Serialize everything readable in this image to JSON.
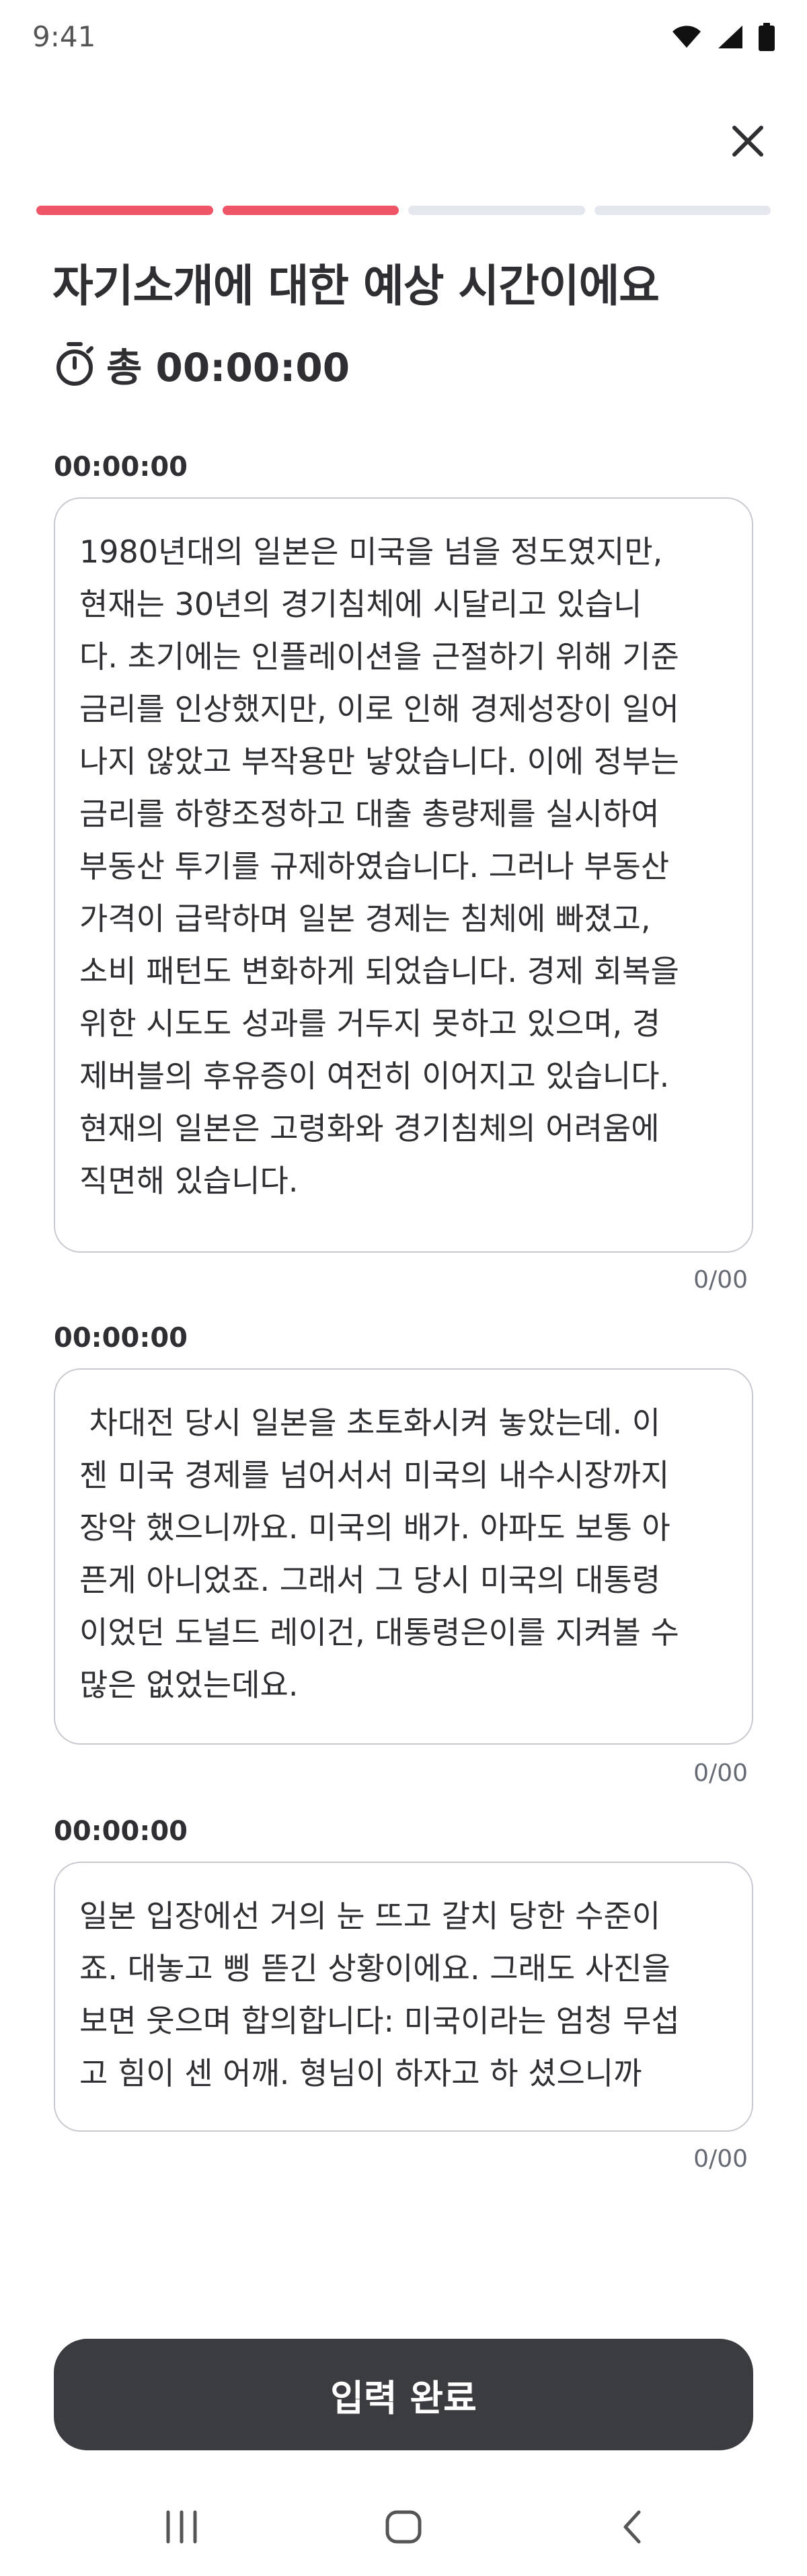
{
  "status_bar": {
    "time": "9:41",
    "icons": [
      "wifi-icon",
      "signal-icon",
      "battery-icon"
    ]
  },
  "header": {
    "close_icon": "close-icon"
  },
  "progress": {
    "total_steps": 4,
    "current_step": 2,
    "active_color": "#ee5566",
    "inactive_color": "#e5e7ee"
  },
  "title": "자기소개에 대한 예상 시간이에요",
  "total": {
    "icon": "stopwatch-icon",
    "label": "총 00:00:00"
  },
  "sections": [
    {
      "time": "00:00:00",
      "text": "1980년대의 일본은 미국을 넘을 정도였지만,\n현재는 30년의 경기침체에 시달리고 있습니\n다. 초기에는 인플레이션을 근절하기 위해 기준\n금리를 인상했지만, 이로 인해 경제성장이 일어\n나지 않았고 부작용만 낳았습니다. 이에 정부는\n금리를 하향조정하고 대출 총량제를 실시하여\n부동산 투기를 규제하였습니다. 그러나 부동산\n가격이 급락하며 일본 경제는 침체에 빠졌고,\n소비 패턴도 변화하게 되었습니다. 경제 회복을\n위한 시도도 성과를 거두지 못하고 있으며, 경\n제버블의 후유증이 여전히 이어지고 있습니다.\n현재의 일본은 고령화와 경기침체의 어려움에\n직면해 있습니다.",
      "count": "0/00"
    },
    {
      "time": "00:00:00",
      "text": " 차대전 당시 일본을 초토화시켜 놓았는데. 이\n젠 미국 경제를 넘어서서 미국의 내수시장까지\n장악 했으니까요. 미국의 배가. 아파도 보통 아\n픈게 아니었죠. 그래서 그 당시 미국의 대통령\n이었던 도널드 레이건, 대통령은이를 지켜볼 수\n많은 없었는데요.",
      "count": "0/00"
    },
    {
      "time": "00:00:00",
      "text": "일본 입장에선 거의 눈 뜨고 갈치 당한 수준이\n죠. 대놓고 삥 뜯긴 상황이에요. 그래도 사진을\n보면 웃으며 합의합니다: 미국이라는 엄청 무섭\n고 힘이 센 어깨. 형님이 하자고 하 셨으니까",
      "count": "0/00"
    }
  ],
  "submit_label": "입력 완료",
  "nav": {
    "icons": [
      "recent-apps-icon",
      "home-icon",
      "back-icon"
    ]
  }
}
